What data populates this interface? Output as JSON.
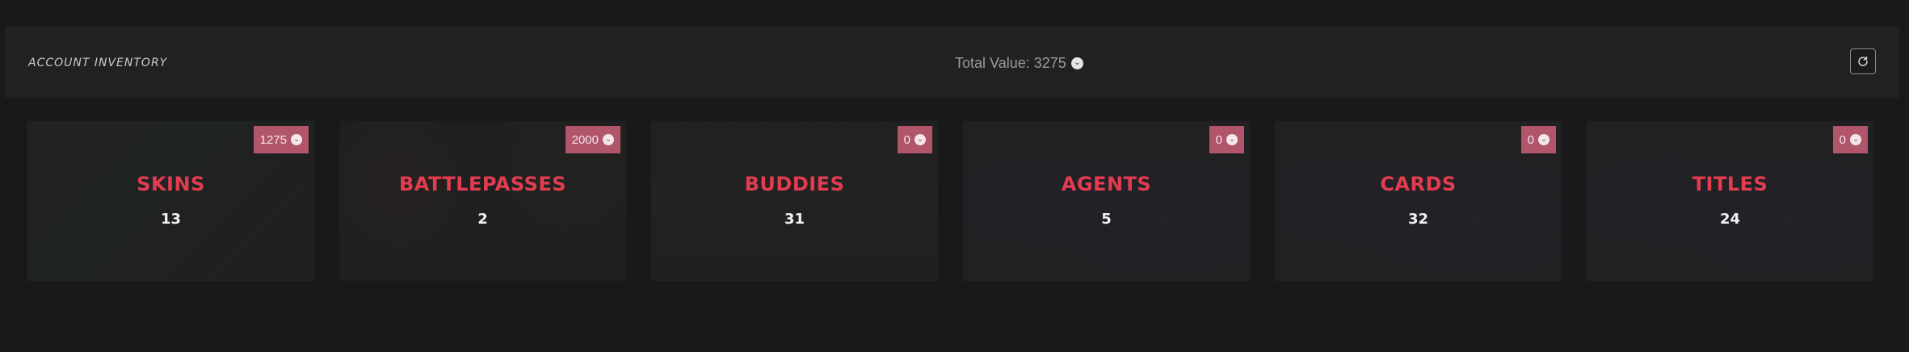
{
  "header": {
    "title": "ACCOUNT INVENTORY",
    "total_value_label": "Total Value: 3275",
    "refresh_icon": "refresh-icon",
    "currency_icon": "valorant-points-icon"
  },
  "colors": {
    "background": "#1a191a",
    "header_bar": "#222122",
    "accent": "#e23c50",
    "badge": "#b1556a"
  },
  "categories": [
    {
      "title": "SKINS",
      "count": "13",
      "value": "1275"
    },
    {
      "title": "BATTLEPASSES",
      "count": "2",
      "value": "2000"
    },
    {
      "title": "BUDDIES",
      "count": "31",
      "value": "0"
    },
    {
      "title": "AGENTS",
      "count": "5",
      "value": "0"
    },
    {
      "title": "CARDS",
      "count": "32",
      "value": "0"
    },
    {
      "title": "TITLES",
      "count": "24",
      "value": "0"
    }
  ]
}
